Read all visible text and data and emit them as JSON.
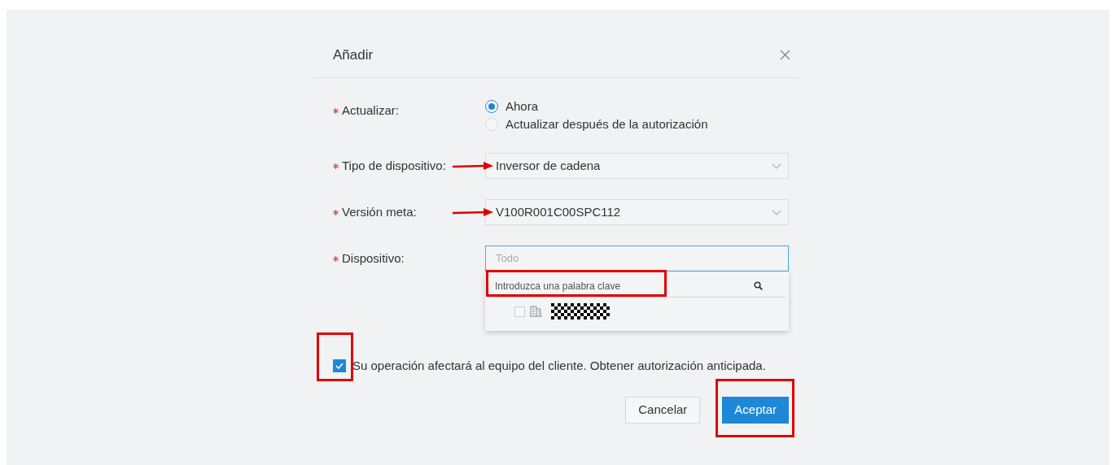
{
  "dialog": {
    "title": "Añadir"
  },
  "fields": [
    {
      "kind": "radio",
      "label": "Actualizar:",
      "required": true,
      "options": [
        {
          "label": "Ahora",
          "selected": true
        },
        {
          "label": "Actualizar después de la autorización",
          "selected": false
        }
      ]
    },
    {
      "kind": "select",
      "label": "Tipo de dispositivo:",
      "required": true,
      "value": "Inversor de cadena",
      "annotated": true
    },
    {
      "kind": "select",
      "label": "Versión meta:",
      "required": true,
      "value": "V100R001C00SPC112",
      "annotated": true
    },
    {
      "kind": "tree-select",
      "label": "Dispositivo:",
      "required": true,
      "placeholder": "Todo",
      "search": {
        "placeholder": "Introduzca una palabra clave",
        "annotated": true
      },
      "items": [
        {
          "checked": false
        }
      ]
    }
  ],
  "consent": {
    "checked": true,
    "text": "Su operación afectará al equipo del cliente. Obtener autorización anticipada.",
    "annotated": true
  },
  "buttons": [
    {
      "label": "Cancelar",
      "kind": "secondary",
      "annotated": false
    },
    {
      "label": "Aceptar",
      "kind": "primary",
      "annotated": true
    }
  ]
}
